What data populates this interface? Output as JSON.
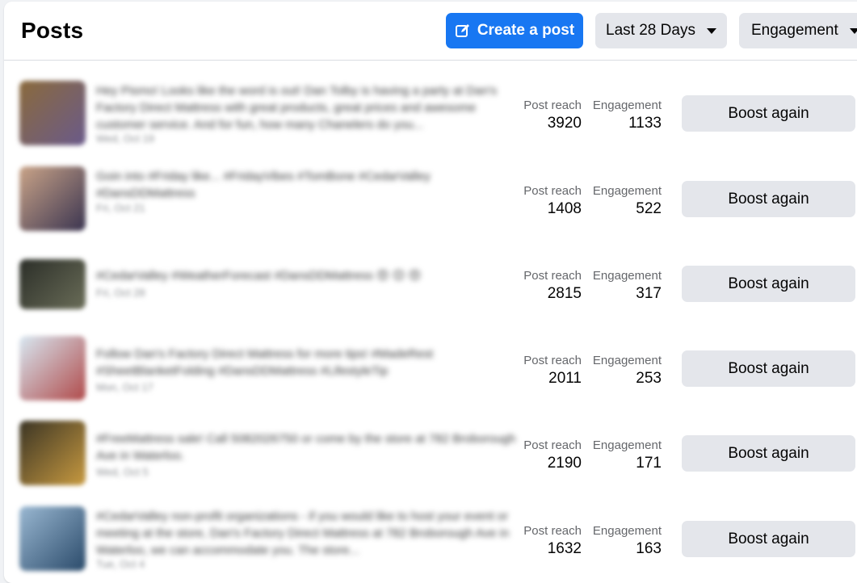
{
  "header": {
    "title": "Posts",
    "create_label": "Create a post",
    "range_label": "Last 28 Days",
    "sort_label": "Engagement"
  },
  "stat_labels": {
    "reach": "Post reach",
    "engagement": "Engagement"
  },
  "posts": [
    {
      "text": "Hey Pismo! Looks like the word is out! Dan Tolby is having a party at Dan's Factory Direct Mattress with great products, great prices and awesome customer service. And for fun, how many Chanelers do you...",
      "date": "Wed, Oct 19",
      "reach": "3920",
      "engagement": "1133",
      "boost": "Boost again",
      "thumb_colors": [
        "#8a6a3c",
        "#6a5a8a"
      ]
    },
    {
      "text": "Goin into #Friday like... #FridayVibes #TomBone #CedarValley #DansDDMattress",
      "date": "Fri, Oct 21",
      "reach": "1408",
      "engagement": "522",
      "boost": "Boost again",
      "thumb_colors": [
        "#caa488",
        "#3a3450"
      ]
    },
    {
      "text": "#CedarValley #WeatherForecast #DansDDMattress 😍 😊 😍",
      "date": "Fri, Oct 28",
      "reach": "2815",
      "engagement": "317",
      "boost": "Boost again",
      "thumb_colors": [
        "#2b2e28",
        "#6a6d58"
      ]
    },
    {
      "text": "Follow Dan's Factory Direct Mattress for more tips! #MadeRest #SheetBlanketFolding #DansDDMattress #LifestyleTip",
      "date": "Mon, Oct 17",
      "reach": "2011",
      "engagement": "253",
      "boost": "Boost again",
      "thumb_colors": [
        "#d8e8f2",
        "#b04a4a"
      ]
    },
    {
      "text": "#FreeMattress sale! Call 5082026750 or come by the store at 782 Broborough Ave in Waterloo.",
      "date": "Wed, Oct 5",
      "reach": "2190",
      "engagement": "171",
      "boost": "Boost again",
      "thumb_colors": [
        "#3a3424",
        "#c89a40"
      ]
    },
    {
      "text": "#CedarValley non-profit organizations - if you would like to host your event or meeting at the store, Dan's Factory Direct Mattress at 782 Broborough Ave in Waterloo, we can accommodate you. The store...",
      "date": "Tue, Oct 4",
      "reach": "1632",
      "engagement": "163",
      "boost": "Boost again",
      "thumb_colors": [
        "#9ab8d2",
        "#2a4a6a"
      ]
    }
  ]
}
